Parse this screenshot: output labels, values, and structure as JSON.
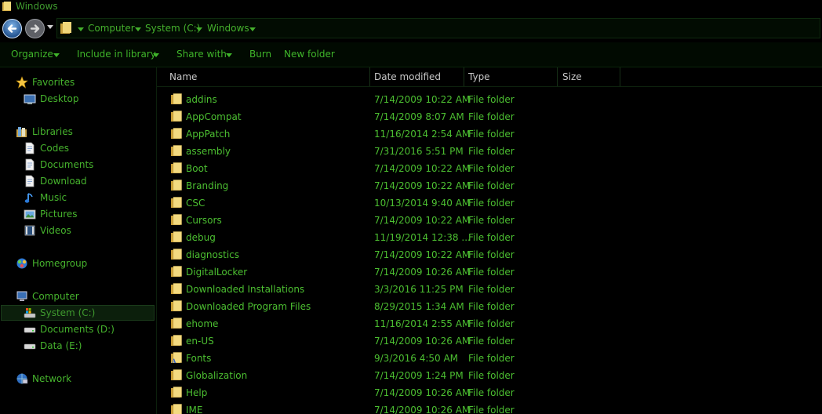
{
  "window": {
    "title": "Windows"
  },
  "address": {
    "crumbs": [
      "Computer",
      "System (C:)",
      "Windows"
    ]
  },
  "toolbar": {
    "organize": "Organize",
    "include_in_library": "Include in library",
    "share_with": "Share with",
    "burn": "Burn",
    "new_folder": "New folder"
  },
  "nav": {
    "favorites": "Favorites",
    "desktop": "Desktop",
    "libraries": "Libraries",
    "codes": "Codes",
    "documents": "Documents",
    "download": "Download",
    "music": "Music",
    "pictures": "Pictures",
    "videos": "Videos",
    "homegroup": "Homegroup",
    "computer": "Computer",
    "system_c": "System (C:)",
    "documents_d": "Documents (D:)",
    "data_e": "Data (E:)",
    "network": "Network"
  },
  "columns": {
    "name": "Name",
    "date_modified": "Date modified",
    "type": "Type",
    "size": "Size"
  },
  "files": [
    {
      "name": "addins",
      "date": "7/14/2009 10:22 AM",
      "type": "File folder"
    },
    {
      "name": "AppCompat",
      "date": "7/14/2009 8:07 AM",
      "type": "File folder"
    },
    {
      "name": "AppPatch",
      "date": "11/16/2014 2:54 AM",
      "type": "File folder"
    },
    {
      "name": "assembly",
      "date": "7/31/2016 5:51 PM",
      "type": "File folder"
    },
    {
      "name": "Boot",
      "date": "7/14/2009 10:22 AM",
      "type": "File folder"
    },
    {
      "name": "Branding",
      "date": "7/14/2009 10:22 AM",
      "type": "File folder"
    },
    {
      "name": "CSC",
      "date": "10/13/2014 9:40 AM",
      "type": "File folder"
    },
    {
      "name": "Cursors",
      "date": "7/14/2009 10:22 AM",
      "type": "File folder"
    },
    {
      "name": "debug",
      "date": "11/19/2014 12:38 ...",
      "type": "File folder"
    },
    {
      "name": "diagnostics",
      "date": "7/14/2009 10:22 AM",
      "type": "File folder"
    },
    {
      "name": "DigitalLocker",
      "date": "7/14/2009 10:26 AM",
      "type": "File folder"
    },
    {
      "name": "Downloaded Installations",
      "date": "3/3/2016 11:25 PM",
      "type": "File folder"
    },
    {
      "name": "Downloaded Program Files",
      "date": "8/29/2015 1:34 AM",
      "type": "File folder"
    },
    {
      "name": "ehome",
      "date": "11/16/2014 2:55 AM",
      "type": "File folder"
    },
    {
      "name": "en-US",
      "date": "7/14/2009 10:26 AM",
      "type": "File folder"
    },
    {
      "name": "Fonts",
      "date": "9/3/2016 4:50 AM",
      "type": "File folder"
    },
    {
      "name": "Globalization",
      "date": "7/14/2009 1:24 PM",
      "type": "File folder"
    },
    {
      "name": "Help",
      "date": "7/14/2009 10:26 AM",
      "type": "File folder"
    },
    {
      "name": "IME",
      "date": "7/14/2009 10:26 AM",
      "type": "File folder"
    }
  ]
}
